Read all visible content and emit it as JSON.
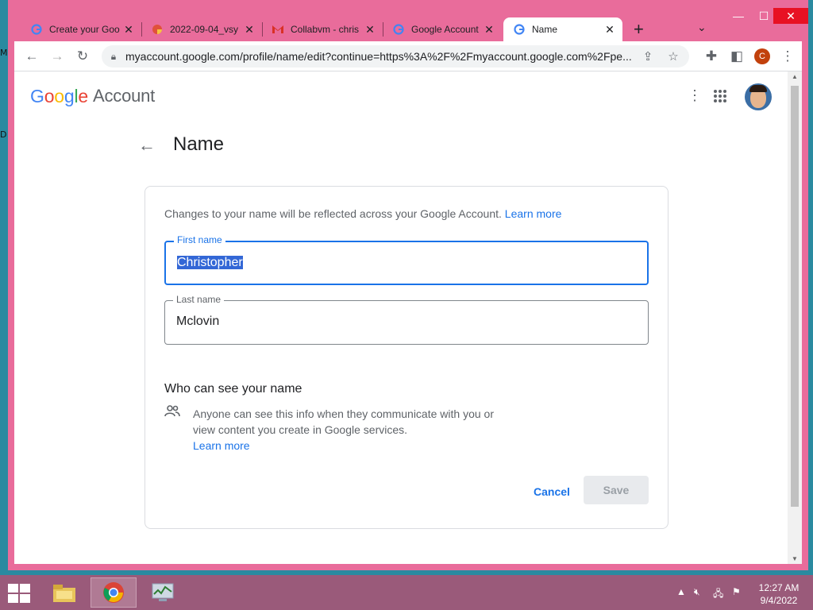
{
  "desktop": {
    "left_letters": [
      "M",
      "D"
    ]
  },
  "browser": {
    "tabs": [
      {
        "title": "Create your Goo",
        "icon": "google-g-icon"
      },
      {
        "title": "2022-09-04_vsy",
        "icon": "pie-favicon-icon"
      },
      {
        "title": "Collabvm - chris",
        "icon": "gmail-icon"
      },
      {
        "title": "Google Account",
        "icon": "google-g-icon"
      },
      {
        "title": "Name",
        "icon": "google-g-icon",
        "active": true
      }
    ],
    "address": "myaccount.google.com/profile/name/edit?continue=https%3A%2F%2Fmyaccount.google.com%2Fpe...",
    "profile_initial": "C"
  },
  "page": {
    "logo_word": "Google",
    "logo_account": "Account",
    "title": "Name",
    "intro": "Changes to your name will be reflected across your Google Account.",
    "intro_link": "Learn more",
    "first_name_label": "First name",
    "first_name_value": "Christopher",
    "last_name_label": "Last name",
    "last_name_value": "Mclovin",
    "who_heading": "Who can see your name",
    "who_desc": "Anyone can see this info when they communicate with you or view content you create in Google services.",
    "who_link": "Learn more",
    "cancel": "Cancel",
    "save": "Save"
  },
  "taskbar": {
    "time": "12:27 AM",
    "date": "9/4/2022"
  },
  "colors": {
    "frame": "#e96c9b",
    "accent": "#1a73e8",
    "taskbar": "#9a5a7a"
  }
}
